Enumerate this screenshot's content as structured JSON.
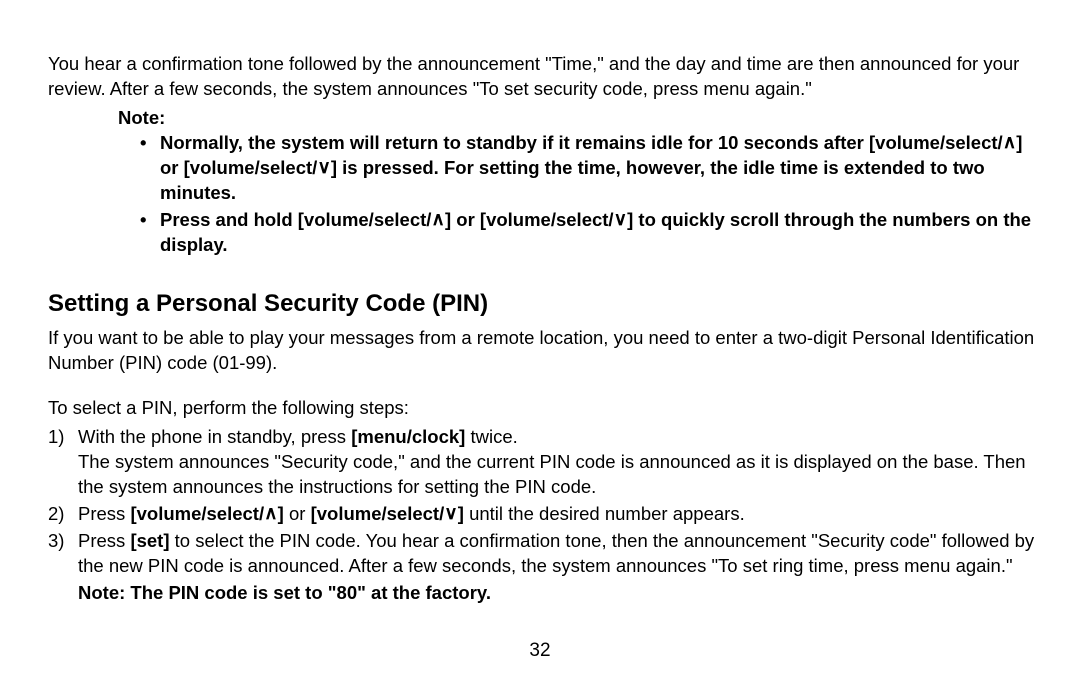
{
  "intro": "You hear a confirmation tone followed by the announcement \"Time,\" and the day and time are then announced for your review. After a few seconds, the system announces \"To set security code, press menu again.\"",
  "noteLabel": "Note:",
  "noteItems": {
    "n1a": "Normally, the system will return to standby if it remains idle for 10 seconds after [volume/select/",
    "arrowUp1": "∧",
    "n1b": "] or [volume/select/",
    "arrowDown1": "∨",
    "n1c": "] is pressed. For setting the time, however, the idle time is extended to two minutes.",
    "n2a": "Press and hold [volume/select/",
    "arrowUp2": "∧",
    "n2b": "] or [volume/select/",
    "arrowDown2": "∨",
    "n2c": "] to quickly scroll through the numbers on the display."
  },
  "heading": "Setting a Personal Security Code (PIN)",
  "section": "If you want to be able to play your messages from a remote location, you need to enter a two-digit Personal Identification Number (PIN) code (01-99).",
  "stepsIntro": "To select a PIN, perform the following steps:",
  "steps": {
    "s1num": "1)",
    "s1a": "With the phone in standby, press ",
    "s1b": "[menu/clock]",
    "s1c": " twice.",
    "s1d": "The system announces \"Security code,\" and the current PIN code is announced as it is displayed on the base. Then the system announces the instructions for setting the PIN code.",
    "s2num": "2)",
    "s2a": "Press ",
    "s2b": "[volume/select/",
    "arrowUp3": "∧",
    "s2c": "]",
    "s2d": " or ",
    "s2e": "[volume/select/",
    "arrowDown3": "∨",
    "s2f": "]",
    "s2g": " until the desired number appears.",
    "s3num": "3)",
    "s3a": "Press ",
    "s3b": "[set]",
    "s3c": " to select the PIN code. You hear a confirmation tone, then the announcement \"Security code\" followed by the new PIN code is announced. After a few seconds, the system announces \"To set ring time, press menu again.\"",
    "s3note": "Note: The PIN code is set to \"80\" at the factory."
  },
  "pageNum": "32"
}
